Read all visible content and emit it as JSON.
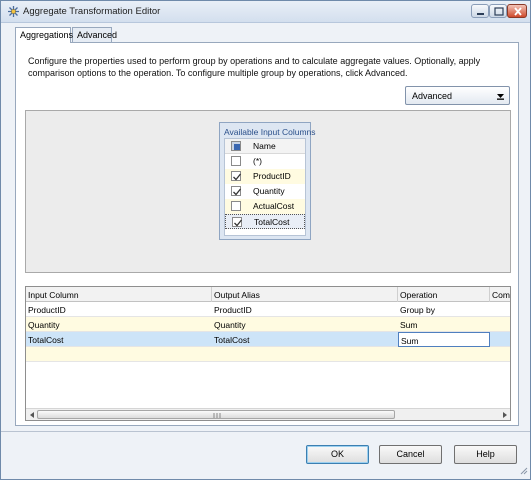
{
  "window": {
    "title": "Aggregate Transformation Editor"
  },
  "tabs": [
    {
      "label": "Aggregations"
    },
    {
      "label": "Advanced"
    }
  ],
  "description": "Configure the properties used to perform group by operations and to calculate aggregate values. Optionally, apply comparison options to the operation. To configure multiple group by operations, click Advanced.",
  "advanced_dropdown": {
    "value": "Advanced"
  },
  "input_columns": {
    "title": "Available Input Columns",
    "header": "Name",
    "rows": [
      {
        "name": "(*)",
        "checked": false
      },
      {
        "name": "ProductID",
        "checked": true
      },
      {
        "name": "Quantity",
        "checked": true
      },
      {
        "name": "ActualCost",
        "checked": false
      },
      {
        "name": "TotalCost",
        "checked": true
      }
    ]
  },
  "grid": {
    "columns": [
      "Input Column",
      "Output Alias",
      "Operation",
      "Com"
    ],
    "rows": [
      {
        "input": "ProductID",
        "alias": "ProductID",
        "operation": "Group by"
      },
      {
        "input": "Quantity",
        "alias": "Quantity",
        "operation": "Sum"
      },
      {
        "input": "TotalCost",
        "alias": "TotalCost",
        "operation": "Sum"
      }
    ]
  },
  "buttons": {
    "ok": "OK",
    "cancel": "Cancel",
    "help": "Help"
  }
}
